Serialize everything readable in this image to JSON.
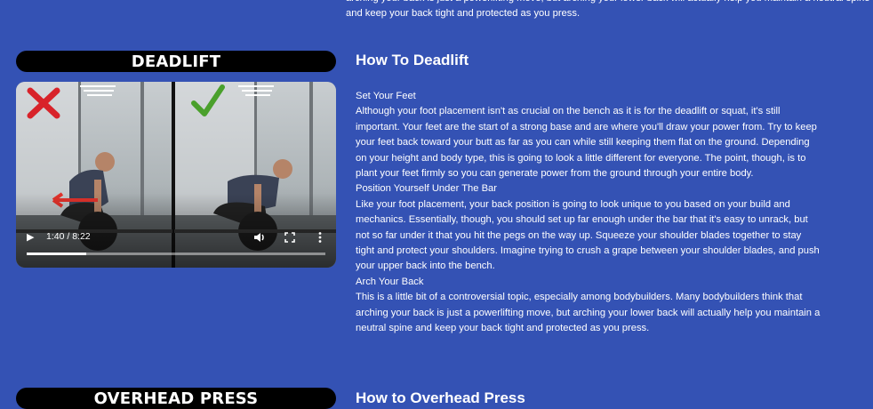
{
  "top_paragraph": "arching your back is just a powerlifting move, but arching your lower back will actually help you maintain a neutral spine and keep your back tight and protected as you press.",
  "deadlift": {
    "label": "DEADLIFT",
    "heading": "How To Deadlift",
    "blocks": [
      {
        "subheading": "Set Your Feet",
        "text": "Although your foot placement isn't as crucial on the bench as it is for the deadlift or squat, it's still important. Your feet are the start of a strong base and are where you'll draw your power from. Try to keep your feet back toward your butt as far as you can while still keeping them flat on the ground. Depending on your height and body type, this is going to look a little different for everyone. The point, though, is to plant your feet firmly so you can generate power from the ground through your entire body."
      },
      {
        "subheading": "Position Yourself Under The Bar",
        "text": "Like your foot placement, your back position is going to look unique to you based on your build and mechanics. Essentially, though, you should set up far enough under the bar that it's easy to unrack, but not so far under it that you hit the pegs on the way up. Squeeze your shoulder blades together to stay tight and protect your shoulders. Imagine trying to crush a grape between your shoulder blades, and push your upper back into the bench."
      },
      {
        "subheading": "Arch Your Back",
        "text": "This is a little bit of a controversial topic, especially among bodybuilders. Many bodybuilders think that arching your back is just a powerlifting move, but arching your lower back will actually help you maintain a neutral spine and keep your back tight and protected as you press."
      }
    ]
  },
  "overhead_press": {
    "label": "OVERHEAD PRESS",
    "heading": "How to Overhead Press"
  },
  "video": {
    "time": "1:40 / 8:22",
    "progress": 0.2,
    "wrong_icon": "x-mark-icon",
    "right_icon": "check-mark-icon",
    "colors": {
      "wrong": "#d8232a",
      "right": "#4aa02c",
      "arrow": "#e0322b"
    }
  }
}
